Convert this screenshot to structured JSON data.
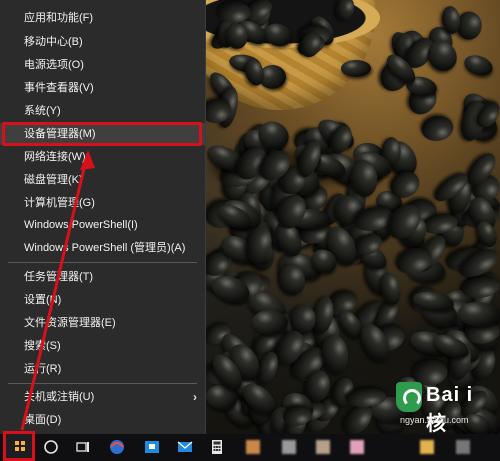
{
  "menu": {
    "items": [
      {
        "label": "应用和功能(F)"
      },
      {
        "label": "移动中心(B)"
      },
      {
        "label": "电源选项(O)"
      },
      {
        "label": "事件查看器(V)"
      },
      {
        "label": "系统(Y)"
      },
      {
        "label": "设备管理器(M)"
      },
      {
        "label": "网络连接(W)"
      },
      {
        "label": "磁盘管理(K)"
      },
      {
        "label": "计算机管理(G)"
      },
      {
        "label": "Windows PowerShell(I)"
      },
      {
        "label": "Windows PowerShell (管理员)(A)"
      },
      {
        "label": "任务管理器(T)"
      },
      {
        "label": "设置(N)"
      },
      {
        "label": "文件资源管理器(E)"
      },
      {
        "label": "搜索(S)"
      },
      {
        "label": "运行(R)"
      },
      {
        "label": "关机或注销(U)"
      },
      {
        "label": "桌面(D)"
      }
    ],
    "highlighted": "设备管理器(M)",
    "submenu_chevron": "›"
  },
  "taskbar": {
    "icons": [
      "windows-start-icon",
      "cortana-icon",
      "task-view-icon",
      "browser-icon",
      "store-icon",
      "mail-icon",
      "file-explorer-icon",
      "calculator-icon"
    ]
  },
  "watermark": {
    "brand": "Bai i 核",
    "url": "ngyan.baidu.com"
  },
  "colors": {
    "accent_red": "#d7101c",
    "menu_bg": "#2b2b2b",
    "menu_text": "#f2f2f2",
    "taskbar_bg": "#0f0f12"
  }
}
